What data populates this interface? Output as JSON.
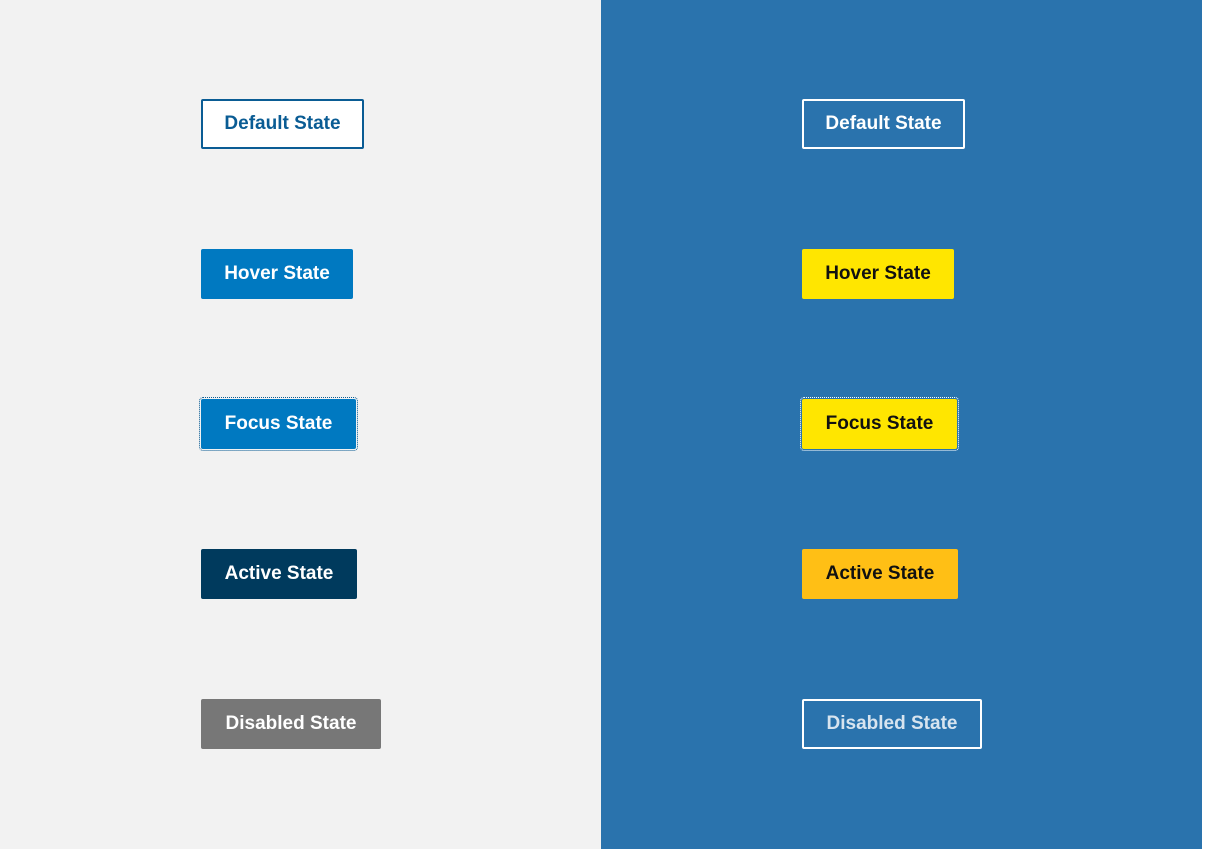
{
  "colors": {
    "light_panel_bg": "#f2f2f2",
    "dark_panel_bg": "#2a73ad",
    "light_default_border": "#0a5c94",
    "light_hover_bg": "#0079c1",
    "light_active_bg": "#003a5d",
    "light_disabled_bg": "#777777",
    "dark_hover_bg": "#ffe600",
    "dark_active_bg": "#ffbf15"
  },
  "light_panel": {
    "buttons": [
      {
        "label": "Default State",
        "state": "default"
      },
      {
        "label": "Hover State",
        "state": "hover"
      },
      {
        "label": "Focus State",
        "state": "focus"
      },
      {
        "label": "Active State",
        "state": "active"
      },
      {
        "label": "Disabled State",
        "state": "disabled"
      }
    ]
  },
  "dark_panel": {
    "buttons": [
      {
        "label": "Default State",
        "state": "default"
      },
      {
        "label": "Hover State",
        "state": "hover"
      },
      {
        "label": "Focus State",
        "state": "focus"
      },
      {
        "label": "Active State",
        "state": "active"
      },
      {
        "label": "Disabled State",
        "state": "disabled"
      }
    ]
  }
}
